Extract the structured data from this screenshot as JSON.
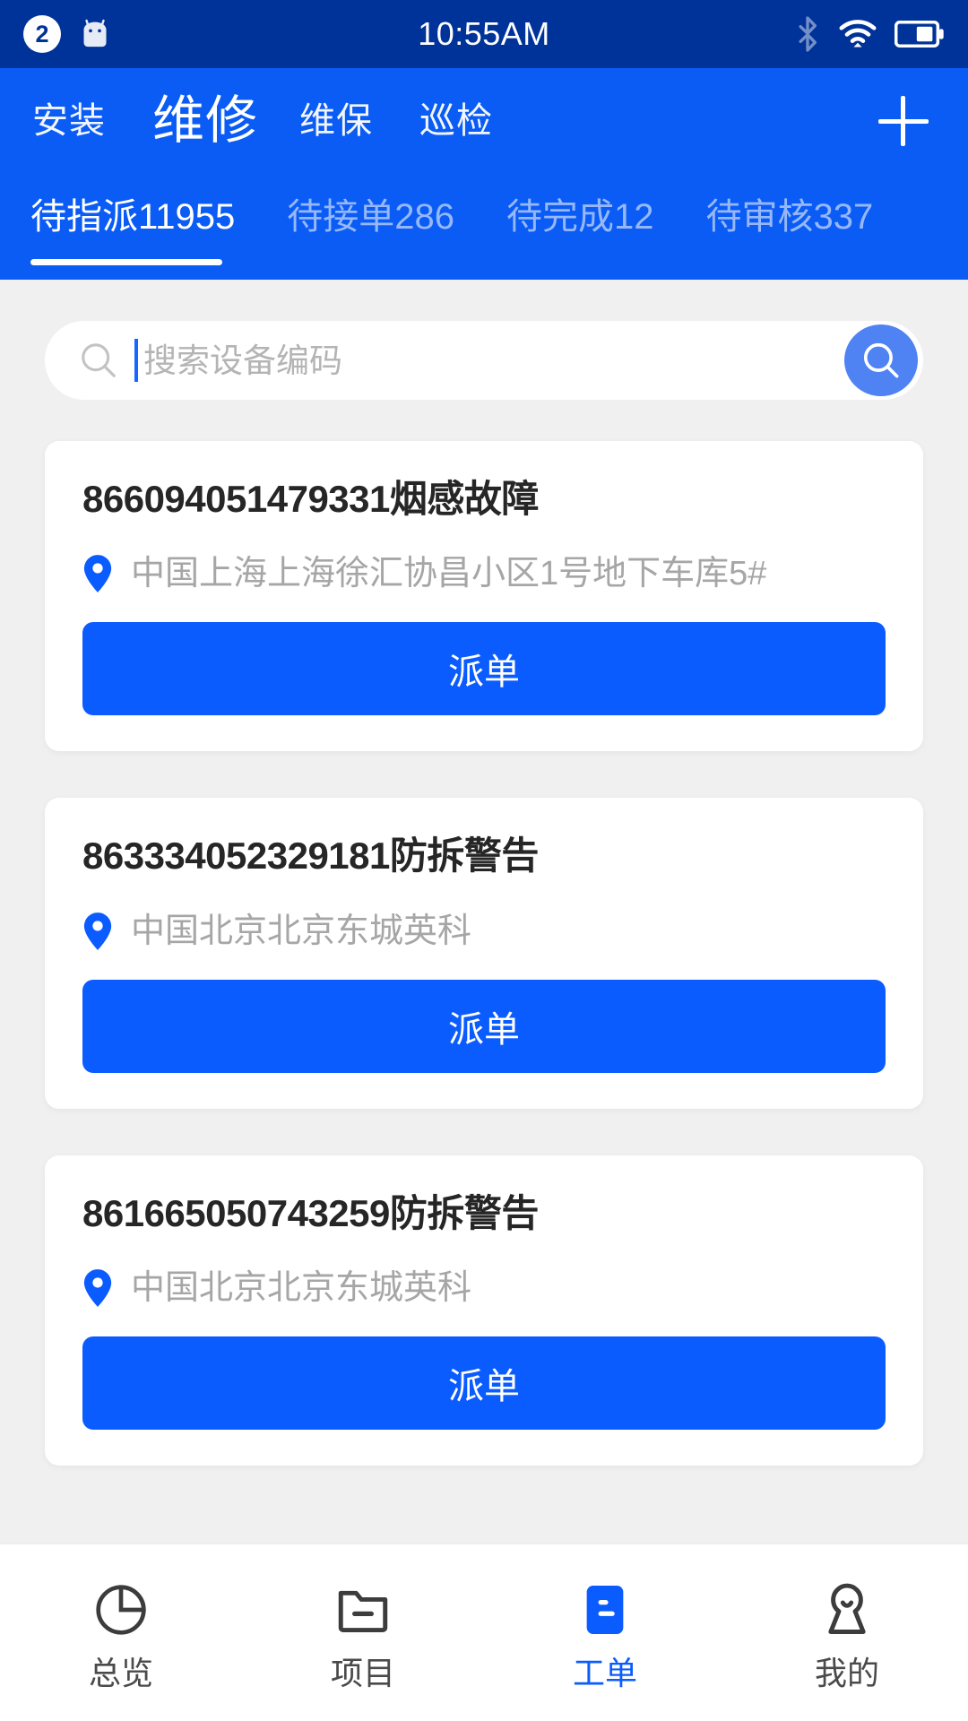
{
  "statusbar": {
    "notification_count": "2",
    "time": "10:55AM",
    "icons": [
      "android-robot-icon",
      "bluetooth-icon",
      "wifi-icon",
      "battery-icon"
    ]
  },
  "header": {
    "main_tabs": [
      {
        "label": "安装",
        "active": false
      },
      {
        "label": "维修",
        "active": true
      },
      {
        "label": "维保",
        "active": false
      },
      {
        "label": "巡检",
        "active": false
      }
    ],
    "add_button": "+",
    "sub_tabs": [
      {
        "label": "待指派11955",
        "active": true
      },
      {
        "label": "待接单286",
        "active": false
      },
      {
        "label": "待完成12",
        "active": false
      },
      {
        "label": "待审核337",
        "active": false
      }
    ]
  },
  "search": {
    "placeholder": "搜索设备编码",
    "value": ""
  },
  "cards": [
    {
      "title": "866094051479331烟感故障",
      "address": "中国上海上海徐汇协昌小区1号地下车库5#",
      "action": "派单"
    },
    {
      "title": "863334052329181防拆警告",
      "address": "中国北京北京东城英科",
      "action": "派单"
    },
    {
      "title": "861665050743259防拆警告",
      "address": "中国北京北京东城英科",
      "action": "派单"
    }
  ],
  "bottomnav": [
    {
      "label": "总览",
      "icon": "pie-chart-icon",
      "active": false
    },
    {
      "label": "项目",
      "icon": "folder-icon",
      "active": false
    },
    {
      "label": "工单",
      "icon": "work-order-icon",
      "active": true
    },
    {
      "label": "我的",
      "icon": "person-icon",
      "active": false
    }
  ],
  "colors": {
    "statusbar_bg": "#003399",
    "header_bg": "#0A5CF5",
    "accent": "#0B5CFF",
    "page_bg": "#f0f0f0",
    "inactive_tab": "#96b8fb"
  }
}
